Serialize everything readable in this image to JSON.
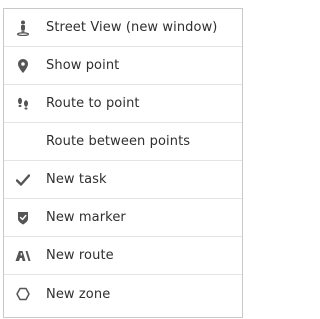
{
  "menu": {
    "items": [
      {
        "label": "Street View (new window)",
        "icon": "street-view-icon"
      },
      {
        "label": "Show point",
        "icon": "map-pin-icon"
      },
      {
        "label": "Route to point",
        "icon": "footsteps-icon"
      },
      {
        "label": "Route between points",
        "icon": ""
      },
      {
        "label": "New task",
        "icon": "checkmark-icon"
      },
      {
        "label": "New marker",
        "icon": "shield-marker-icon"
      },
      {
        "label": "New route",
        "icon": "road-icon"
      },
      {
        "label": "New zone",
        "icon": "zone-icon"
      }
    ]
  },
  "colors": {
    "icon": "#555555",
    "text": "#2f2f2f",
    "divider": "#e4e4e4",
    "border": "#c9c9c9"
  }
}
